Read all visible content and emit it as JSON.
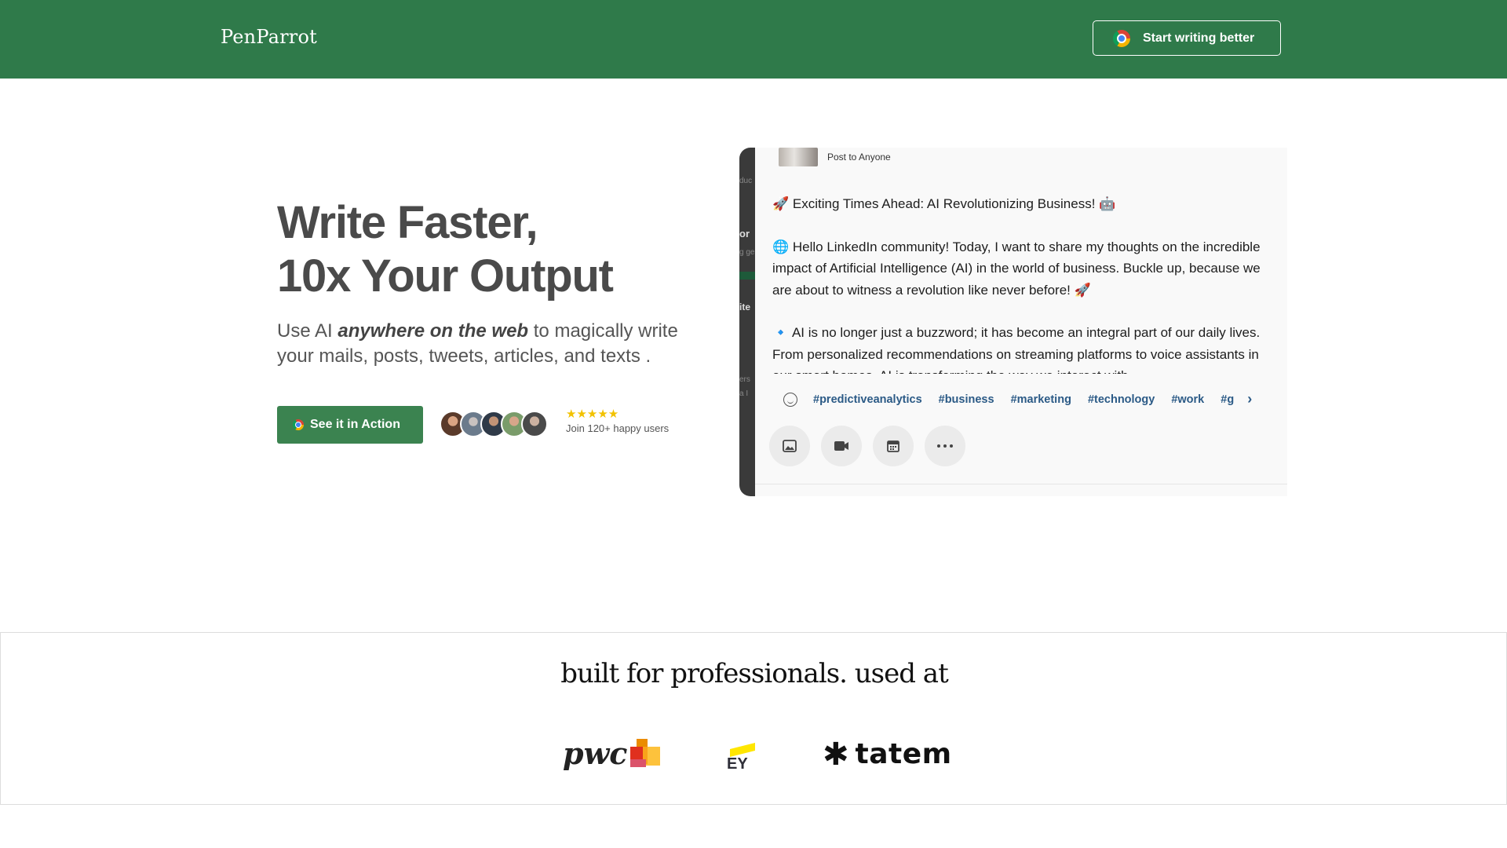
{
  "header": {
    "brand": "PenParrot",
    "cta_label": "Start writing better",
    "colors": {
      "bar": "#2f7a4a"
    }
  },
  "hero": {
    "title_line1": "Write Faster,",
    "title_line2": "10x Your Output",
    "subtitle_pre": "Use AI ",
    "subtitle_emph": "anywhere on the web",
    "subtitle_post": " to magically write your mails, posts, tweets, articles, and texts .",
    "action_label": "See it in Action",
    "rating_stars": "★★★★★",
    "rating": 5,
    "social_proof": "Join 120+ happy users"
  },
  "preview": {
    "post_to": "Post to Anyone",
    "side_fragments": [
      "duc",
      "or",
      "g ge",
      "ite",
      "ers",
      "a I"
    ],
    "paragraphs": [
      "🚀 Exciting Times Ahead: AI Revolutionizing Business! 🤖",
      "🌐 Hello LinkedIn community! Today, I want to share my thoughts on the incredible impact of Artificial Intelligence (AI) in the world of business. Buckle up, because we are about to witness a revolution like never before! 🚀",
      "🔹 AI is no longer just a buzzword; it has become an integral part of our daily lives. From personalized recommendations on streaming platforms to voice assistants in our smart homes, AI is transforming the way we interact with"
    ],
    "hashtags": [
      "#predictiveanalytics",
      "#business",
      "#marketing",
      "#technology",
      "#work",
      "#g"
    ],
    "action_icons": [
      "image-icon",
      "video-icon",
      "calendar-icon",
      "more-icon"
    ]
  },
  "logos": {
    "title": "built for professionals. used at",
    "pwc": "pwc",
    "ey": "EY",
    "tatem": "tatem"
  }
}
